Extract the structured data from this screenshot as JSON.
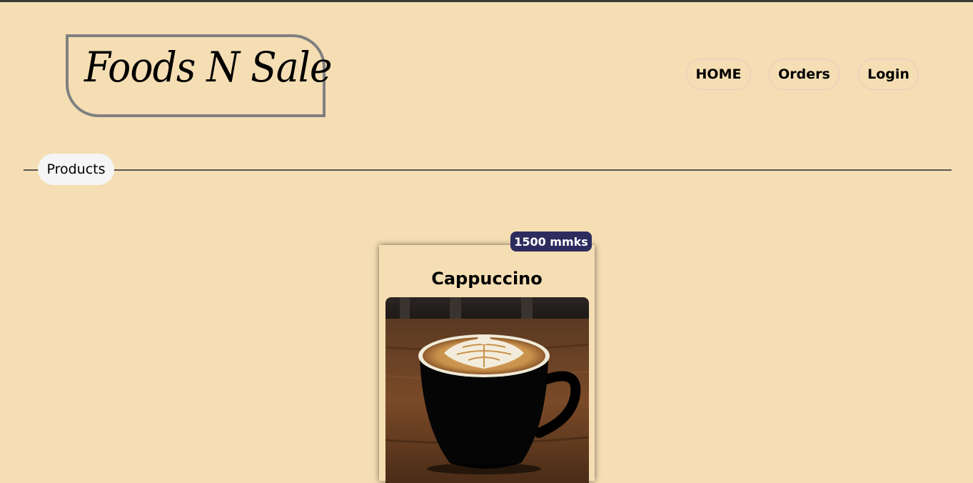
{
  "header": {
    "logo_text": "Foods N Sale",
    "nav": [
      {
        "label": "HOME"
      },
      {
        "label": "Orders"
      },
      {
        "label": "Login"
      }
    ]
  },
  "section": {
    "label": "Products"
  },
  "products": [
    {
      "name": "Cappuccino",
      "price": "1500 mmks",
      "image_icon": "coffee-cup-image"
    }
  ],
  "colors": {
    "background": "#f5deb3",
    "badge": "#2c2c5e",
    "logo_border": "#808080",
    "nav_border": "#f1c4c4"
  }
}
